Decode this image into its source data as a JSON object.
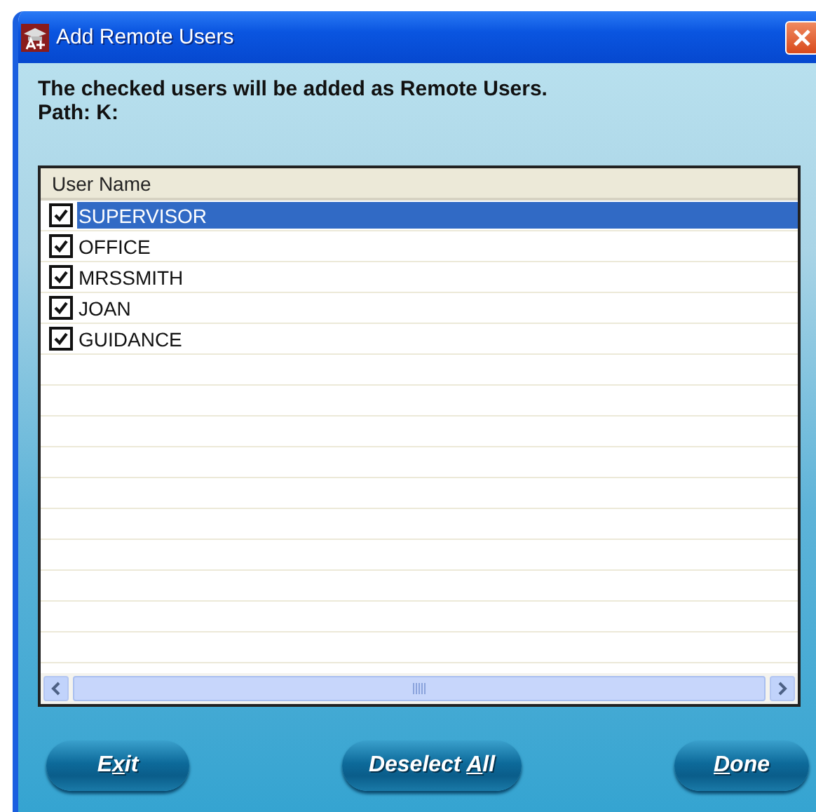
{
  "window": {
    "title": "Add Remote Users"
  },
  "message": "The checked users will be added as Remote Users.",
  "path": "Path: K:",
  "list": {
    "column": "User Name",
    "rows": [
      {
        "name": "SUPERVISOR",
        "checked": true,
        "selected": true
      },
      {
        "name": "OFFICE",
        "checked": true,
        "selected": false
      },
      {
        "name": "MRSSMITH",
        "checked": true,
        "selected": false
      },
      {
        "name": "JOAN",
        "checked": true,
        "selected": false
      },
      {
        "name": "GUIDANCE",
        "checked": true,
        "selected": false
      }
    ]
  },
  "buttons": [
    {
      "label_before": "E",
      "label_underlined": "x",
      "label_after": "it"
    },
    {
      "label_before": "Deselect ",
      "label_underlined": "A",
      "label_after": "ll"
    },
    {
      "label_underlined": "D",
      "label_after": "one"
    }
  ]
}
